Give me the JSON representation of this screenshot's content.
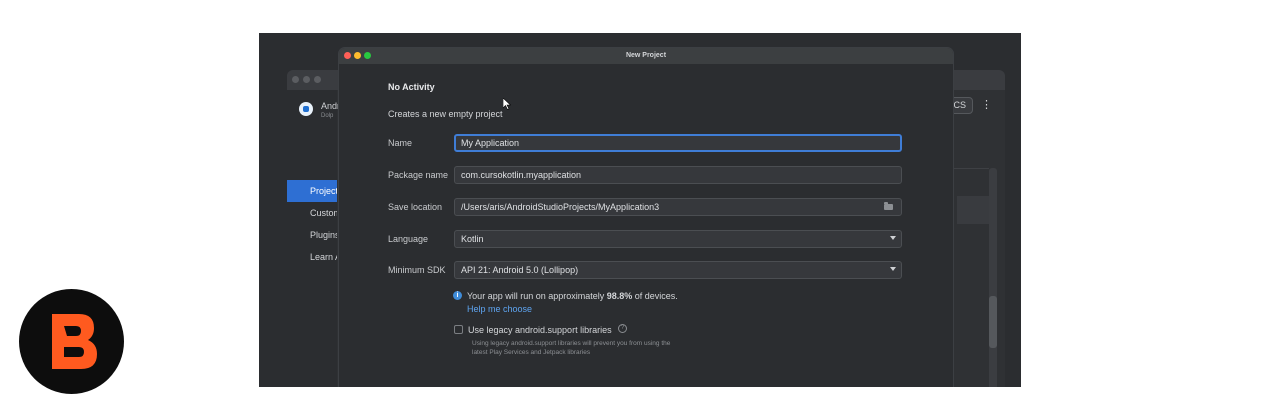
{
  "welcome": {
    "app_name": "Andr",
    "app_sub": "Dolp",
    "sidebar": [
      {
        "label": "Project",
        "active": true
      },
      {
        "label": "Custom",
        "active": false
      },
      {
        "label": "Plugins",
        "active": false
      },
      {
        "label": "Learn A",
        "active": false
      }
    ],
    "right_button": "CS",
    "kebab": "⋮"
  },
  "dialog": {
    "title": "New Project",
    "template_name": "No Activity",
    "template_desc": "Creates a new empty project",
    "fields": {
      "name": {
        "label": "Name",
        "value": "My Application"
      },
      "package": {
        "label": "Package name",
        "value": "com.cursokotlin.myapplication"
      },
      "save_location": {
        "label": "Save location",
        "value": "/Users/aris/AndroidStudioProjects/MyApplication3"
      },
      "language": {
        "label": "Language",
        "value": "Kotlin"
      },
      "min_sdk": {
        "label": "Minimum SDK",
        "value": "API 21: Android 5.0 (Lollipop)"
      }
    },
    "info": {
      "prefix": "Your app will run on approximately ",
      "percent": "98.8%",
      "suffix": " of devices.",
      "link": "Help me choose"
    },
    "legacy": {
      "label": "Use legacy android.support libraries",
      "checked": false,
      "desc_line1": "Using legacy android.support libraries will prevent you from using the",
      "desc_line2": "latest Play Services and Jetpack libraries"
    }
  },
  "colors": {
    "accent": "#3f7dd6",
    "link": "#5ea4f0",
    "logo_orange": "#ff5a1f"
  },
  "icons": {
    "info": "info-icon",
    "help": "question-circle-icon",
    "folder": "folder-icon",
    "dropdown": "chevron-down-icon"
  }
}
